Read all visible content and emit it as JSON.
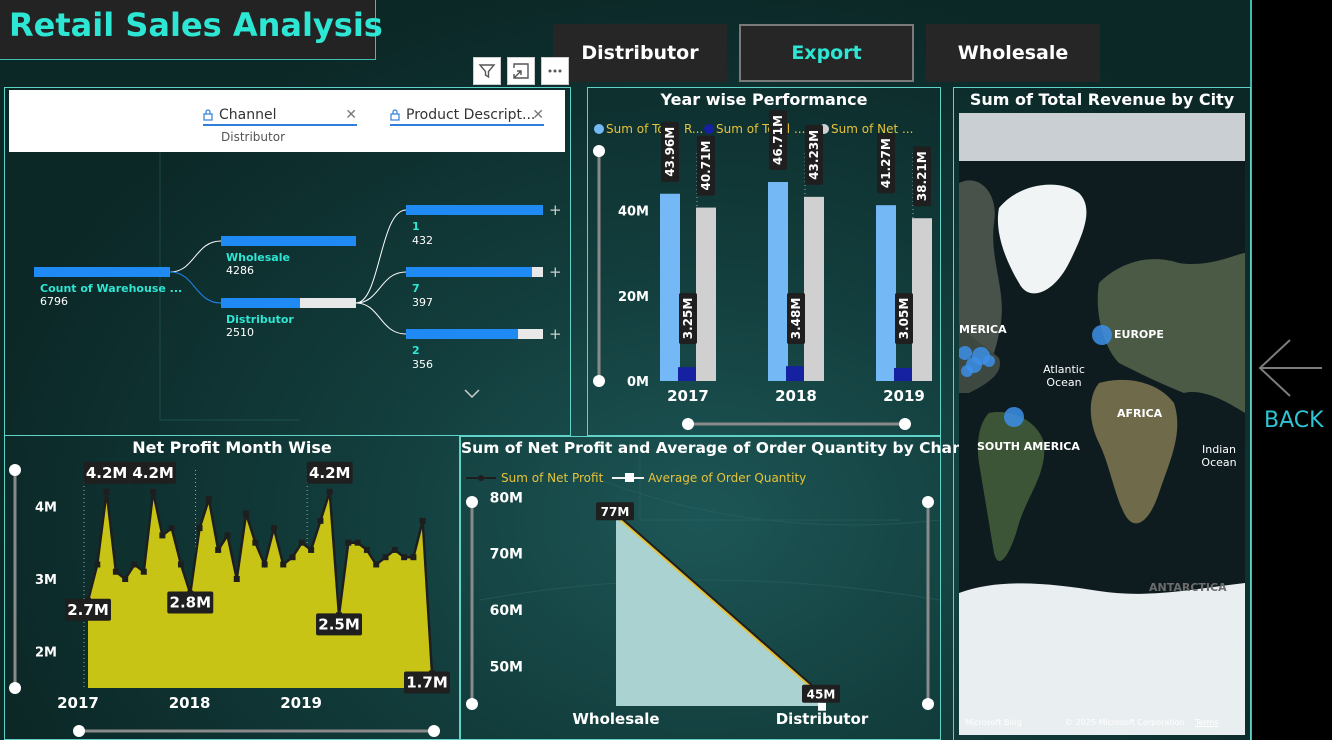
{
  "header": {
    "title": "Retail Sales Analysis"
  },
  "nav": {
    "buttons": [
      {
        "label": "Distributor",
        "active": false
      },
      {
        "label": "Export",
        "active": true
      },
      {
        "label": "Wholesale",
        "active": false
      }
    ]
  },
  "back": {
    "label": "BACK"
  },
  "colors": {
    "accent": "#2de6d3",
    "primary_blue": "#1f89f4",
    "light_blue": "#74b9f5",
    "navy": "#1521a1",
    "gray": "#d0d0d0",
    "olive": "#c8c416",
    "teal_light": "#a9d2d1"
  },
  "decomp": {
    "filters": [
      {
        "label": "Channel",
        "value": "Distributor"
      },
      {
        "label": "Product Descript...",
        "value": ""
      }
    ],
    "root": {
      "label": "Count of Warehouse ...",
      "value": "6796"
    },
    "level1": [
      {
        "label": "Wholesale",
        "value": "4286",
        "fill": 1.0
      },
      {
        "label": "Distributor",
        "value": "2510",
        "fill": 0.5
      }
    ],
    "level2": [
      {
        "label": "1",
        "value": "432",
        "fill": 1.0
      },
      {
        "label": "7",
        "value": "397",
        "fill": 0.92
      },
      {
        "label": "2",
        "value": "356",
        "fill": 0.82
      }
    ]
  },
  "year_chart": {
    "title": "Year wise Performance",
    "legend": [
      "Sum of Total R...",
      "Sum of Total ...",
      "Sum of Net ..."
    ],
    "ylabels": [
      "40M",
      "20M",
      "0M"
    ]
  },
  "net_profit_chart": {
    "title": "Net Profit Month Wise",
    "ylabels": [
      "4M",
      "3M",
      "2M"
    ],
    "xlabels": [
      "2017",
      "2018",
      "2019"
    ]
  },
  "channel_chart": {
    "title": "Sum of Net Profit and Average of Order Quantity by Channel",
    "legend": [
      "Sum of Net Profit",
      "Average of Order Quantity"
    ],
    "ylabels": [
      "80M",
      "70M",
      "60M",
      "50M"
    ]
  },
  "map": {
    "title": "Sum of Total Revenue by City",
    "labels": [
      "MERICA",
      "EUROPE",
      "Atlantic Ocean",
      "AFRICA",
      "SOUTH AMERICA",
      "Indian Ocean",
      "ANTARCTICA"
    ],
    "attribution": [
      "Microsoft Bing",
      "© 2025 Microsoft Corporation",
      "Terms"
    ]
  },
  "chart_data": [
    {
      "type": "bar",
      "title": "Year wise Performance",
      "categories": [
        "2017",
        "2018",
        "2019"
      ],
      "series": [
        {
          "name": "Sum of Total R...",
          "values": [
            43.96,
            46.71,
            41.27
          ],
          "labels": [
            "43.96M",
            "46.71M",
            "41.27M"
          ]
        },
        {
          "name": "Sum of Total ...",
          "values": [
            3.25,
            3.48,
            3.05
          ],
          "labels": [
            "3.25M",
            "3.48M",
            "3.05M"
          ]
        },
        {
          "name": "Sum of Net ...",
          "values": [
            40.71,
            43.23,
            38.21
          ],
          "labels": [
            "40.71M",
            "43.23M",
            "38.21M"
          ]
        }
      ],
      "ylim": [
        0,
        50
      ],
      "unit": "M",
      "yticks": [
        "0M",
        "20M",
        "40M"
      ],
      "legend_position": "top"
    },
    {
      "type": "area",
      "title": "Net Profit Month Wise",
      "x_ticks": [
        "2017",
        "2018",
        "2019"
      ],
      "values": [
        2.7,
        3.2,
        4.2,
        3.1,
        3.0,
        3.2,
        3.1,
        4.2,
        3.6,
        3.7,
        3.2,
        2.8,
        3.7,
        4.1,
        3.4,
        3.6,
        3.0,
        3.9,
        3.5,
        3.2,
        3.7,
        3.2,
        3.3,
        3.5,
        3.4,
        3.8,
        4.2,
        2.5,
        3.5,
        3.5,
        3.4,
        3.2,
        3.3,
        3.4,
        3.3,
        3.3,
        3.8,
        1.7
      ],
      "labels": [
        {
          "index": 2,
          "text": "4.2M"
        },
        {
          "index": 7,
          "text": "4.2M"
        },
        {
          "index": 26,
          "text": "4.2M"
        },
        {
          "index": 0,
          "text": "2.7M"
        },
        {
          "index": 11,
          "text": "2.8M"
        },
        {
          "index": 27,
          "text": "2.5M"
        },
        {
          "index": 37,
          "text": "1.7M"
        }
      ],
      "ylim": [
        1.5,
        4.5
      ],
      "yticks": [
        "2M",
        "3M",
        "4M"
      ]
    },
    {
      "type": "area",
      "title": "Sum of Net Profit and Average of Order Quantity by Channel",
      "categories": [
        "Wholesale",
        "Distributor"
      ],
      "series": [
        {
          "name": "Sum of Net Profit",
          "values": [
            77,
            45
          ],
          "labels": [
            "77M",
            "45M"
          ]
        },
        {
          "name": "Average of Order Quantity",
          "values": [
            77,
            45
          ]
        }
      ],
      "ylim": [
        43,
        82
      ],
      "yticks": [
        "50M",
        "60M",
        "70M",
        "80M"
      ],
      "legend_position": "top"
    }
  ]
}
